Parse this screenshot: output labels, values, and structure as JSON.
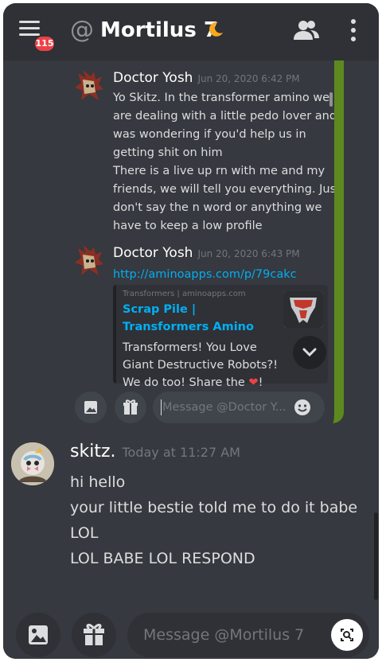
{
  "header": {
    "unread_count": "115",
    "at_symbol": "@",
    "title": "Mortilus 7",
    "status": "idle-moon-icon"
  },
  "embedded": {
    "messages": [
      {
        "author": "Doctor Yosh",
        "time": "Jun 20, 2020 6:42 PM",
        "lines": [
          "Yo Skitz. In the transformer amino we",
          "are dealing with a little pedo lover and I",
          "was wondering if you'd help us in",
          "getting shit on him",
          "There is a live up rn with me and my",
          "friends, we will tell you everything. Just",
          "don't say the n word or anything we",
          "have to keep a low profile"
        ]
      },
      {
        "author": "Doctor Yosh",
        "time": "Jun 20, 2020 6:43 PM",
        "link": "http://aminoapps.com/p/79cakc",
        "card": {
          "provider": "Transformers | aminoapps.com",
          "title": "Scrap Pile | Transformers Amino",
          "desc_lines": [
            "Transformers! You Love",
            "Giant Destructive Robots?!",
            "We do too! Share the"
          ],
          "desc_end": "!"
        }
      }
    ],
    "composer_placeholder": "Message @Doctor Y..."
  },
  "message": {
    "author": "skitz.",
    "time": "Today at 11:27 AM",
    "lines": [
      "hi hello",
      "your little bestie told me to do it babe",
      "LOL",
      "LOL BABE LOL RESPOND"
    ]
  },
  "composer": {
    "placeholder": "Message @Mortilus 7"
  },
  "colors": {
    "background": "#36393f",
    "header": "#2f3136",
    "badge": "#ed4245",
    "link": "#00aff4",
    "idle_moon": "#faa81a",
    "embed_border": "#5d8a1e"
  }
}
